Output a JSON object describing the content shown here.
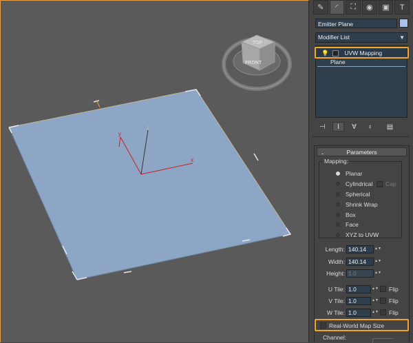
{
  "toolbar": {
    "tabs": [
      {
        "icon": "create-icon",
        "glyph": "✎"
      },
      {
        "icon": "modify-icon",
        "glyph": "◜"
      },
      {
        "icon": "hierarchy-icon",
        "glyph": "⛶"
      },
      {
        "icon": "motion-icon",
        "glyph": "◉"
      },
      {
        "icon": "display-icon",
        "glyph": "▣"
      },
      {
        "icon": "utilities-icon",
        "glyph": "T"
      }
    ]
  },
  "object": {
    "name": "Emitter Plane",
    "color": "#a9c3ef"
  },
  "modifier_list": {
    "label": "Modifier List"
  },
  "stack": {
    "items": [
      {
        "label": "UVW Mapping",
        "selected": true
      },
      {
        "label": "Plane",
        "selected": false
      }
    ]
  },
  "stack_buttons": [
    {
      "icon": "pin-stack-icon",
      "glyph": "⊣"
    },
    {
      "icon": "show-end-result-icon",
      "glyph": "I"
    },
    {
      "icon": "make-unique-icon",
      "glyph": "∀"
    },
    {
      "icon": "remove-modifier-icon",
      "glyph": "♁"
    },
    {
      "icon": "configure-sets-icon",
      "glyph": "▤"
    }
  ],
  "parameters": {
    "title": "Parameters",
    "collapse_glyph": "-",
    "mapping_label": "Mapping:",
    "mapping_options": [
      {
        "label": "Planar",
        "selected": true
      },
      {
        "label": "Cylindrical",
        "selected": false
      },
      {
        "label": "Spherical",
        "selected": false
      },
      {
        "label": "Shrink Wrap",
        "selected": false
      },
      {
        "label": "Box",
        "selected": false
      },
      {
        "label": "Face",
        "selected": false
      },
      {
        "label": "XYZ to UVW",
        "selected": false
      }
    ],
    "cap_label": "Cap",
    "length_label": "Length:",
    "length_value": "140.14",
    "width_label": "Width:",
    "width_value": "140.14",
    "height_label": "Height:",
    "height_value": "1.0",
    "u_tile_label": "U Tile:",
    "u_tile_value": "1.0",
    "v_tile_label": "V Tile:",
    "v_tile_value": "1.0",
    "w_tile_label": "W Tile:",
    "w_tile_value": "1.0",
    "flip_label": "Flip",
    "real_world_label": "Real-World Map Size",
    "channel_label": "Channel:"
  },
  "viewport": {
    "viewcube_top": "TOP",
    "viewcube_front": "FRONT",
    "axis_x": "x",
    "axis_y": "y",
    "axis_z": "z",
    "plane_color": "#8ea6c6",
    "highlight_color": "#f0a82a"
  }
}
